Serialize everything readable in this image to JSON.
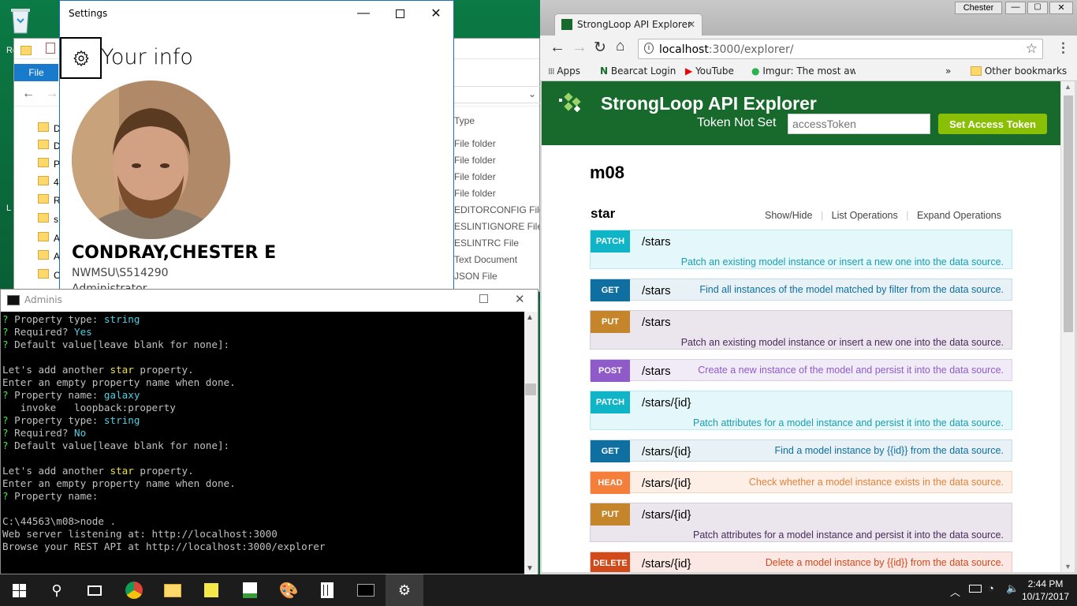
{
  "desktop": {
    "icon1_label": "Re",
    "icon2_label": "L"
  },
  "explorer": {
    "file_tab": "File",
    "tree": [
      "D",
      "D",
      "P",
      "4",
      "R",
      "s",
      "A",
      "A",
      "C"
    ],
    "type_header": "Type",
    "types": [
      "File folder",
      "File folder",
      "File folder",
      "File folder",
      "EDITORCONFIG File",
      "ESLINTIGNORE File",
      "ESLINTRC File",
      "Text Document",
      "JSON File"
    ]
  },
  "settings": {
    "title": "Settings",
    "heading": "Your info",
    "name": "CONDRAY,CHESTER E",
    "domain_user": "NWMSU\\S514290",
    "role": "Administrator"
  },
  "cmd": {
    "title": "Adminis",
    "lines": [
      [
        {
          "t": "? ",
          "c": "cq"
        },
        {
          "t": "Property type: ",
          "c": ""
        },
        {
          "t": "string",
          "c": "cy"
        }
      ],
      [
        {
          "t": "? ",
          "c": "cq"
        },
        {
          "t": "Required? ",
          "c": ""
        },
        {
          "t": "Yes",
          "c": "cy"
        }
      ],
      [
        {
          "t": "? ",
          "c": "cq"
        },
        {
          "t": "Default value[leave blank for none]:",
          "c": ""
        }
      ],
      [
        {
          "t": "",
          "c": ""
        }
      ],
      [
        {
          "t": "Let's add another ",
          "c": ""
        },
        {
          "t": "star",
          "c": "cyel"
        },
        {
          "t": " property.",
          "c": ""
        }
      ],
      [
        {
          "t": "Enter an empty property name when done.",
          "c": ""
        }
      ],
      [
        {
          "t": "? ",
          "c": "cq"
        },
        {
          "t": "Property name: ",
          "c": ""
        },
        {
          "t": "galaxy",
          "c": "cy"
        }
      ],
      [
        {
          "t": "   invoke   loopback:property",
          "c": ""
        }
      ],
      [
        {
          "t": "? ",
          "c": "cq"
        },
        {
          "t": "Property type: ",
          "c": ""
        },
        {
          "t": "string",
          "c": "cy"
        }
      ],
      [
        {
          "t": "? ",
          "c": "cq"
        },
        {
          "t": "Required? ",
          "c": ""
        },
        {
          "t": "No",
          "c": "cy"
        }
      ],
      [
        {
          "t": "? ",
          "c": "cq"
        },
        {
          "t": "Default value[leave blank for none]:",
          "c": ""
        }
      ],
      [
        {
          "t": "",
          "c": ""
        }
      ],
      [
        {
          "t": "Let's add another ",
          "c": ""
        },
        {
          "t": "star",
          "c": "cyel"
        },
        {
          "t": " property.",
          "c": ""
        }
      ],
      [
        {
          "t": "Enter an empty property name when done.",
          "c": ""
        }
      ],
      [
        {
          "t": "? ",
          "c": "cq"
        },
        {
          "t": "Property name:",
          "c": ""
        }
      ],
      [
        {
          "t": "",
          "c": ""
        }
      ],
      [
        {
          "t": "C:\\44563\\m08>node .",
          "c": ""
        }
      ],
      [
        {
          "t": "Web server listening at: http://localhost:3000",
          "c": ""
        }
      ],
      [
        {
          "t": "Browse your REST API at http://localhost:3000/explorer",
          "c": ""
        }
      ]
    ]
  },
  "chrome": {
    "profile": "Chester",
    "tab_title": "StrongLoop API Explorer",
    "url_host": "localhost",
    "url_rest": ":3000/explorer/",
    "bookmarks": {
      "apps": "Apps",
      "b1": "Bearcat Login",
      "b2": "YouTube",
      "b3": "Imgur: The most awe",
      "more": "»",
      "other": "Other bookmarks"
    }
  },
  "explorer_page": {
    "brand": "StrongLoop API Explorer",
    "token_status": "Token Not Set",
    "token_placeholder": "accessToken",
    "set_token_label": "Set Access Token",
    "section_title": "m08",
    "resource": "star",
    "links": [
      "Show/Hide",
      "List Operations",
      "Expand Operations"
    ],
    "operations": [
      {
        "method": "PATCH",
        "path": "/stars",
        "desc": "Patch an existing model instance or insert a new one into the data source.",
        "color": "#0fb5c7",
        "bg": "#e4f8fb",
        "border": "#b8eaf0",
        "text": "#1a9db0",
        "two": true
      },
      {
        "method": "GET",
        "path": "/stars",
        "desc": "Find all instances of the model matched by filter from the data source.",
        "color": "#0f6fa0",
        "bg": "#e8f1f6",
        "border": "#c6dcea",
        "text": "#0f6fa0",
        "two": false
      },
      {
        "method": "PUT",
        "path": "/stars",
        "desc": "Patch an existing model instance or insert a new one into the data source.",
        "color": "#c5862b",
        "bg": "#ebe6ee",
        "border": "#d4ccd9",
        "text": "#4a2a5a",
        "two": true
      },
      {
        "method": "POST",
        "path": "/stars",
        "desc": "Create a new instance of the model and persist it into the data source.",
        "color": "#8e5bc9",
        "bg": "#f1ebf8",
        "border": "#ddd0ee",
        "text": "#8e5bc9",
        "two": false
      },
      {
        "method": "PATCH",
        "path": "/stars/{id}",
        "desc": "Patch attributes for a model instance and persist it into the data source.",
        "color": "#0fb5c7",
        "bg": "#e4f8fb",
        "border": "#b8eaf0",
        "text": "#1a9db0",
        "two": true
      },
      {
        "method": "GET",
        "path": "/stars/{id}",
        "desc": "Find a model instance by {{id}} from the data source.",
        "color": "#0f6fa0",
        "bg": "#e8f1f6",
        "border": "#c6dcea",
        "text": "#0f6fa0",
        "two": false
      },
      {
        "method": "HEAD",
        "path": "/stars/{id}",
        "desc": "Check whether a model instance exists in the data source.",
        "color": "#f57e3b",
        "bg": "#fdefe5",
        "border": "#f7d3bd",
        "text": "#e0823e",
        "two": false
      },
      {
        "method": "PUT",
        "path": "/stars/{id}",
        "desc": "Patch attributes for a model instance and persist it into the data source.",
        "color": "#c5862b",
        "bg": "#ebe6ee",
        "border": "#d4ccd9",
        "text": "#4a2a5a",
        "two": true
      },
      {
        "method": "DELETE",
        "path": "/stars/{id}",
        "desc": "Delete a model instance by {{id}} from the data source.",
        "color": "#d14a1b",
        "bg": "#fbe7e3",
        "border": "#f1c6bd",
        "text": "#d14a1b",
        "two": false
      }
    ]
  },
  "taskbar": {
    "time": "2:44 PM",
    "date": "10/17/2017"
  }
}
